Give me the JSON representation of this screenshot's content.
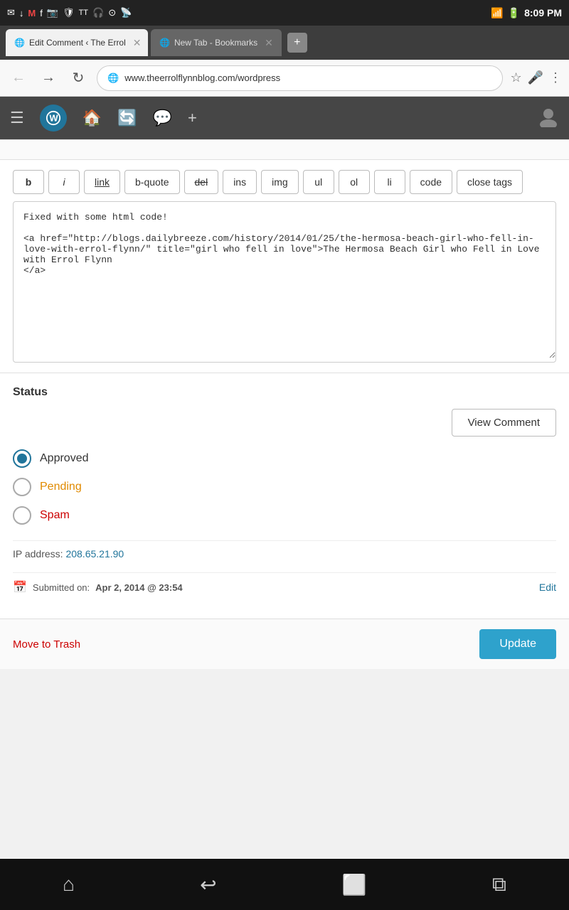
{
  "statusBar": {
    "time": "8:09 PM",
    "icons_left": [
      "✉",
      "↓",
      "M",
      "f",
      "📷",
      "🛡",
      "TalkTalk",
      "🎧",
      "📡"
    ],
    "battery": "🔋",
    "signal": "📶"
  },
  "browser": {
    "activeTab": {
      "label": "Edit Comment ‹ The Errol",
      "favicon": "🌐"
    },
    "inactiveTab": {
      "label": "New Tab - Bookmarks",
      "favicon": "🌐"
    },
    "url": "www.theerrolflynnblog.com/wordpress"
  },
  "wpToolbar": {
    "menuIcon": "≡",
    "homeIcon": "🏠",
    "refreshIcon": "🔄",
    "commentIcon": "💬",
    "addIcon": "+"
  },
  "formatToolbar": {
    "buttons": [
      {
        "label": "b",
        "style": ""
      },
      {
        "label": "i",
        "style": "italic"
      },
      {
        "label": "link",
        "style": "underline"
      },
      {
        "label": "b-quote",
        "style": ""
      },
      {
        "label": "del",
        "style": "strikethrough"
      },
      {
        "label": "ins",
        "style": ""
      },
      {
        "label": "img",
        "style": ""
      },
      {
        "label": "ul",
        "style": ""
      },
      {
        "label": "ol",
        "style": ""
      },
      {
        "label": "li",
        "style": ""
      },
      {
        "label": "code",
        "style": ""
      },
      {
        "label": "close tags",
        "style": ""
      }
    ]
  },
  "editor": {
    "content": "Fixed with some html code!\n\n<a href=\"http://blogs.dailybreeze.com/history/2014/01/25/the-hermosa-beach-girl-who-fell-in-love-with-errol-flynn/\" title=\"girl who fell in love\">The Hermosa Beach Girl who Fell in Love with Errol Flynn\n</a>"
  },
  "status": {
    "title": "Status",
    "viewCommentBtn": "View Comment",
    "options": [
      {
        "label": "Approved",
        "value": "approved",
        "selected": true,
        "color": "approved"
      },
      {
        "label": "Pending",
        "value": "pending",
        "selected": false,
        "color": "pending"
      },
      {
        "label": "Spam",
        "value": "spam",
        "selected": false,
        "color": "spam"
      }
    ],
    "ipLabel": "IP address:",
    "ipAddress": "208.65.21.90",
    "submittedLabel": "Submitted on:",
    "submittedDate": "Apr 2, 2014 @ 23:54",
    "editLink": "Edit"
  },
  "actions": {
    "moveToTrash": "Move to Trash",
    "update": "Update"
  },
  "androidNav": {
    "back": "⌂",
    "home": "↩",
    "recents": "⬜"
  }
}
